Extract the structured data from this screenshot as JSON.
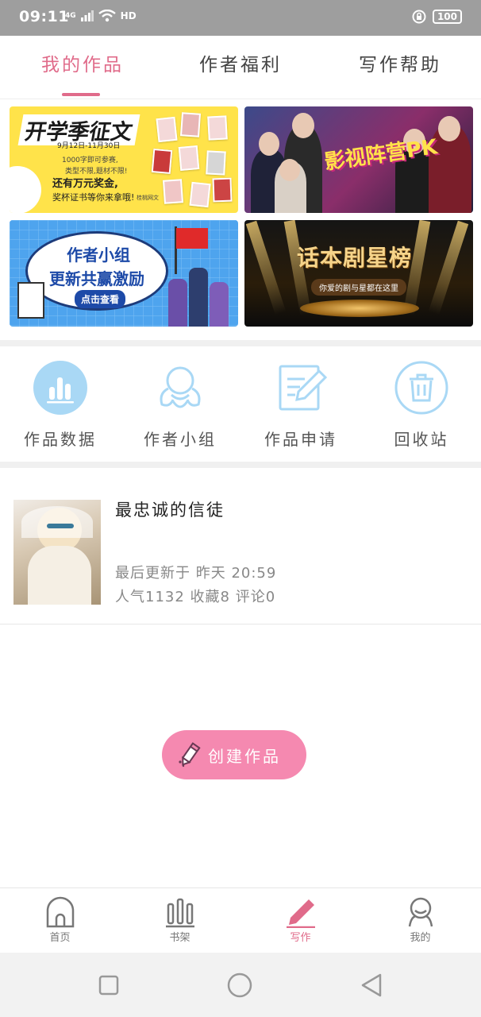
{
  "status_bar": {
    "time": "09:11",
    "network": "4G",
    "hd": "HD",
    "battery": "100",
    "colors": {
      "bar": "#9e9e9e",
      "text": "#ffffff"
    }
  },
  "top_tabs": {
    "items": [
      {
        "label": "我的作品",
        "active": true
      },
      {
        "label": "作者福利",
        "active": false
      },
      {
        "label": "写作帮助",
        "active": false
      }
    ],
    "active_color": "#e06b8a"
  },
  "banners": [
    {
      "name": "essay-contest",
      "title": "开学季征文",
      "date": "9月12日-11月30日",
      "line1": "1000字即可参赛,",
      "line2": "类型不限,题材不限!",
      "line3": "还有万元奖金,",
      "line4": "奖杯证书等你来拿哦!",
      "signature": "桂桃网文"
    },
    {
      "name": "film-camp-pk",
      "title": "影视阵营PK"
    },
    {
      "name": "author-group",
      "title_line1": "作者小组",
      "title_line2": "更新共赢激励",
      "button": "点击查看"
    },
    {
      "name": "script-star-ranking",
      "title": "话本剧星榜",
      "subtitle": "你爱的剧与星都在这里"
    }
  ],
  "quick_actions": [
    {
      "label": "作品数据",
      "icon": "bar-chart-icon"
    },
    {
      "label": "作者小组",
      "icon": "group-icon"
    },
    {
      "label": "作品申请",
      "icon": "edit-doc-icon"
    },
    {
      "label": "回收站",
      "icon": "trash-icon"
    }
  ],
  "work": {
    "title": "最忠诚的信徒",
    "last_update": "最后更新于 昨天 20:59",
    "stats": "人气1132 收藏8 评论0"
  },
  "create_button": {
    "label": "创建作品",
    "color": "#f589b0"
  },
  "bottom_nav": [
    {
      "label": "首页",
      "icon": "home-icon",
      "active": false
    },
    {
      "label": "书架",
      "icon": "bookshelf-icon",
      "active": false
    },
    {
      "label": "写作",
      "icon": "pen-icon",
      "active": true
    },
    {
      "label": "我的",
      "icon": "profile-icon",
      "active": false
    }
  ],
  "system_nav": [
    "recent-apps-icon",
    "home-circle-icon",
    "back-triangle-icon"
  ]
}
